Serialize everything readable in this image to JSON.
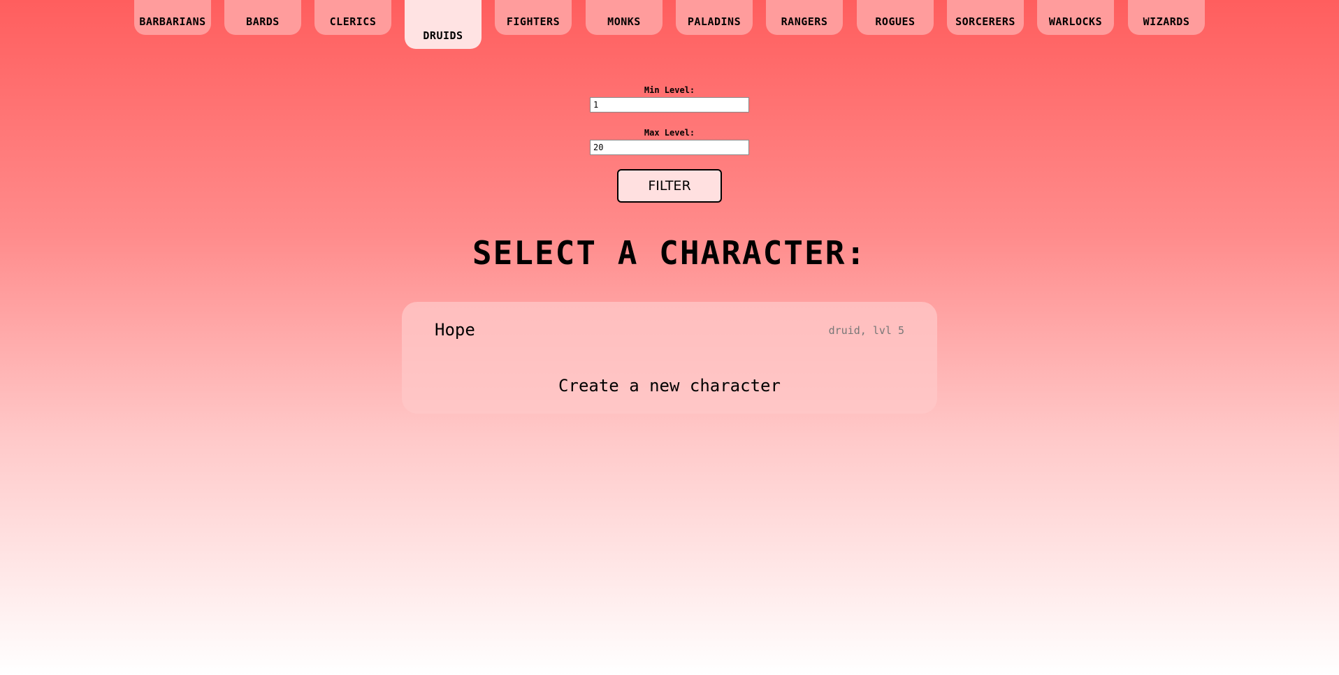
{
  "tabs": [
    {
      "label": "BARBARIANS",
      "active": false
    },
    {
      "label": "BARDS",
      "active": false
    },
    {
      "label": "CLERICS",
      "active": false
    },
    {
      "label": "DRUIDS",
      "active": true
    },
    {
      "label": "FIGHTERS",
      "active": false
    },
    {
      "label": "MONKS",
      "active": false
    },
    {
      "label": "PALADINS",
      "active": false
    },
    {
      "label": "RANGERS",
      "active": false
    },
    {
      "label": "ROGUES",
      "active": false
    },
    {
      "label": "SORCERERS",
      "active": false
    },
    {
      "label": "WARLOCKS",
      "active": false
    },
    {
      "label": "WIZARDS",
      "active": false
    }
  ],
  "filter": {
    "min_label": "Min Level:",
    "min_value": "1",
    "max_label": "Max Level:",
    "max_value": "20",
    "button_label": "FILTER"
  },
  "heading": "SELECT A CHARACTER:",
  "characters": [
    {
      "name": "Hope",
      "meta": "druid, lvl 5"
    }
  ],
  "create_label": "Create a new character",
  "colors": {
    "tab": "#ff9c9c",
    "tab_active": "#ffe3e3",
    "card": "#ffc8c8"
  }
}
